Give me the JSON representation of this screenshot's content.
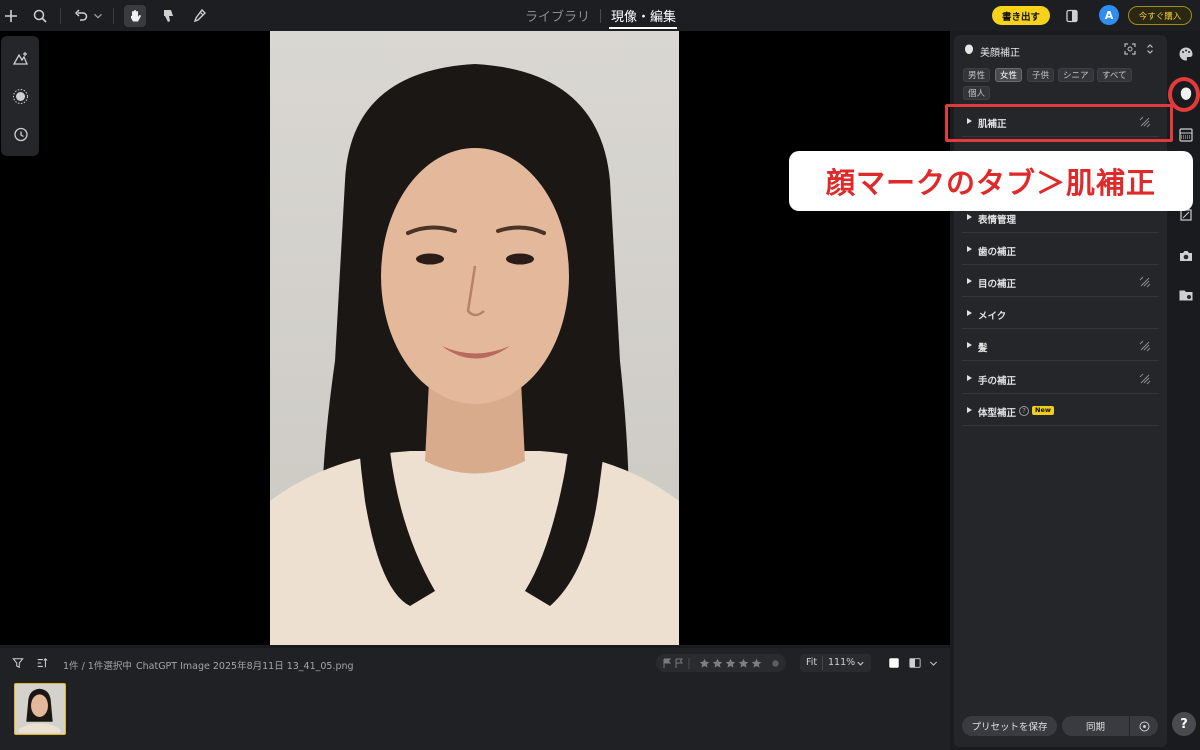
{
  "topbar": {
    "mode_tabs": [
      {
        "label": "ライブラリ",
        "active": false
      },
      {
        "label": "現像・編集",
        "active": true
      }
    ],
    "export_label": "書き出す",
    "avatar_letter": "A",
    "buy_label": "今すぐ購入",
    "accent_color": "#f7d21b"
  },
  "filmstrip": {
    "count_text": "1件 / 1件選択中",
    "filename": "ChatGPT Image 2025年8月11日 13_41_05.png",
    "fit_label": "Fit",
    "zoom_value": "111%"
  },
  "panel": {
    "title": "美顔補正",
    "chips": [
      {
        "label": "男性",
        "active": false
      },
      {
        "label": "女性",
        "active": true
      },
      {
        "label": "子供",
        "active": false
      },
      {
        "label": "シニア",
        "active": false
      },
      {
        "label": "すべて",
        "active": false
      },
      {
        "label": "個人",
        "active": false
      }
    ],
    "sections": [
      {
        "label": "肌補正",
        "has_reset": true
      },
      {
        "label": "表情管理",
        "has_reset": false
      },
      {
        "label": "歯の補正",
        "has_reset": false
      },
      {
        "label": "目の補正",
        "has_reset": true
      },
      {
        "label": "メイク",
        "has_reset": false
      },
      {
        "label": "髪",
        "has_reset": true
      },
      {
        "label": "手の補正",
        "has_reset": true
      },
      {
        "label": "体型補正",
        "has_reset": false
      }
    ],
    "new_badge": "New",
    "help_glyph": "?",
    "preset_label": "プリセットを保存",
    "sync_label": "同期"
  },
  "rail": {
    "help_label": "?"
  },
  "annotation": {
    "callout_text": "顔マークのタブ＞肌補正",
    "highlight_color": "#e23b3b"
  }
}
